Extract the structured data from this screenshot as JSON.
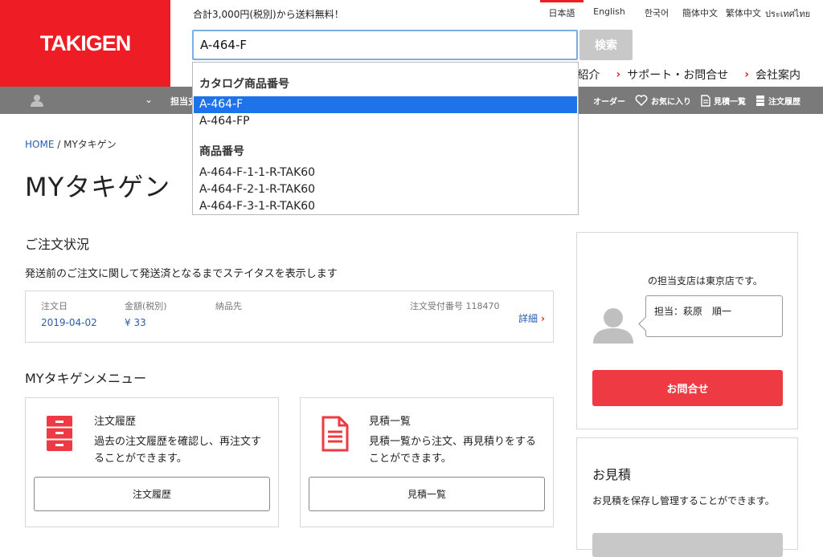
{
  "header": {
    "logo": "TAKIGEN",
    "promo": "合計3,000円(税別)から送料無料！",
    "languages": [
      "日本語",
      "English",
      "한국어",
      "簡体中文",
      "繁体中文",
      "ประเทศไทย"
    ],
    "search_value": "A-464-F",
    "search_button": "検索",
    "nav": {
      "partial": "紹介",
      "support": "サポート・お問合せ",
      "company": "会社案内"
    }
  },
  "graybar": {
    "tantou": "担当支",
    "links": [
      "オーダー",
      "お気に入り",
      "見積一覧",
      "注文履歴"
    ]
  },
  "breadcrumb": {
    "home": "HOME",
    "sep": "/",
    "current": "MYタキゲン"
  },
  "page_title": "MYタキゲン",
  "orders": {
    "title": "ご注文状況",
    "desc": "発送前のご注文に関して発送済となるまでステイタスを表示します",
    "labels": {
      "date": "注文日",
      "amount": "金額(税別)",
      "dest": "納品先",
      "receipt": "注文受付番号 118470"
    },
    "values": {
      "date": "2019-04-02",
      "amount": "¥ 33"
    },
    "detail": "詳細"
  },
  "menu": {
    "title": "MYタキゲンメニュー",
    "cards": [
      {
        "title": "注文履歴",
        "desc": "過去の注文履歴を確認し、再注文することができます。",
        "button": "注文履歴"
      },
      {
        "title": "見積一覧",
        "desc": "見積一覧から注文、再見積りをすることができます。",
        "button": "見積一覧"
      }
    ]
  },
  "sidebar": {
    "branch": "の担当支店は東京店です。",
    "rep": "担当：萩原　順一",
    "contact_button": "お問合せ",
    "quote_title": "お見積",
    "quote_desc": "お見積を保存し管理することができます。"
  },
  "autocomplete": {
    "group1": "カタログ商品番号",
    "group1_items": [
      "A-464-F",
      "A-464-FP"
    ],
    "group2": "商品番号",
    "group2_items": [
      "A-464-F-1-1-R-TAK60",
      "A-464-F-2-1-R-TAK60",
      "A-464-F-3-1-R-TAK60"
    ]
  },
  "colors": {
    "brand": "#ee1c25",
    "link": "#2a5db0",
    "selected": "#1e73e8"
  }
}
